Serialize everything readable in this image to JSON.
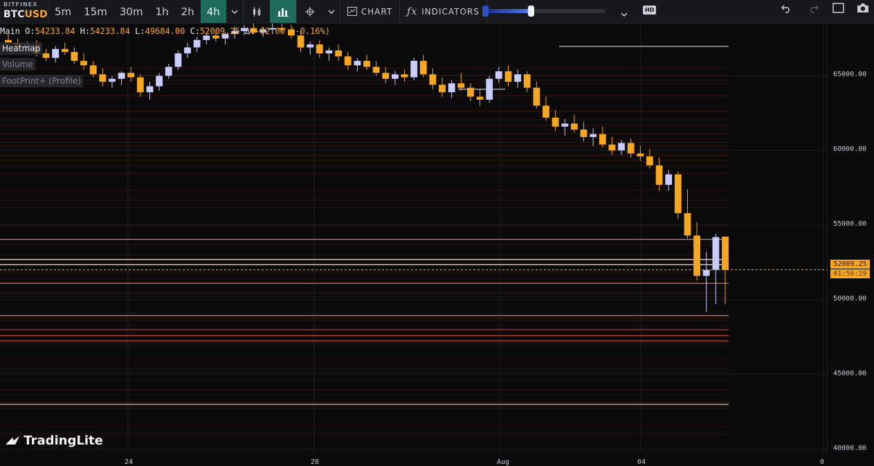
{
  "toolbar": {
    "exchange": "BITFINEX",
    "pair_base": "BTC",
    "pair_quote": "USD",
    "timeframes": [
      "5m",
      "15m",
      "30m",
      "1h",
      "2h",
      "4h"
    ],
    "active_timeframe": "4h",
    "chart_label": "CHART",
    "indicators_label": "INDICATORS",
    "hd_label": "HD",
    "icons": [
      "chevron-down-icon",
      "candles-icon",
      "bars-icon",
      "crosshair-icon",
      "chart-icon",
      "function-icon",
      "undo-icon",
      "redo-icon",
      "window-icon",
      "camera-icon"
    ]
  },
  "info": {
    "main_label": "Main",
    "o_label": "O:",
    "o": "54233.84",
    "h_label": "H:",
    "h": "54233.84",
    "l_label": "L:",
    "l": "49684.00",
    "c_label": "C:",
    "c": "52009.25",
    "delta_label": "Δ:",
    "delta": "-82.00",
    "delta_pct": "(-0.16%)"
  },
  "panes": {
    "heatmap": "Heatmap",
    "volume": "Volume",
    "footprint": "FootPrint+ (Profile)"
  },
  "last_price": {
    "value": "52009.25",
    "countdown": "01:56:29",
    "color": "#f5a623"
  },
  "brand": {
    "logo_text": "TradingLite"
  },
  "colors": {
    "up": "#c8ccff",
    "down": "#f5a623",
    "bg": "#0a0a0b",
    "accent": "#1e6b5c"
  },
  "chart_data": {
    "type": "candlestick",
    "title": "",
    "y_ticks": [
      "65000.00",
      "60000.00",
      "55000.00",
      "50000.00",
      "45000.00",
      "40000.00"
    ],
    "x_ticks": [
      "24",
      "28",
      "Aug",
      "04",
      "0"
    ],
    "ylim": [
      39750,
      68500
    ],
    "candles": [
      [
        67400,
        67800,
        67000,
        67200
      ],
      [
        67200,
        67500,
        66800,
        66900
      ],
      [
        66900,
        67300,
        66500,
        67100
      ],
      [
        67100,
        67400,
        66300,
        66500
      ],
      [
        66500,
        66800,
        66000,
        66200
      ],
      [
        66200,
        67000,
        65900,
        66800
      ],
      [
        66800,
        67200,
        66400,
        66600
      ],
      [
        66600,
        66900,
        65800,
        66000
      ],
      [
        66000,
        66500,
        65400,
        65700
      ],
      [
        65700,
        66000,
        64900,
        65100
      ],
      [
        65100,
        65500,
        64300,
        64600
      ],
      [
        64600,
        65000,
        64200,
        64800
      ],
      [
        64800,
        65300,
        64400,
        65200
      ],
      [
        65200,
        65600,
        64600,
        64900
      ],
      [
        64900,
        65100,
        63600,
        63900
      ],
      [
        63900,
        64600,
        63400,
        64300
      ],
      [
        64300,
        65200,
        64000,
        65000
      ],
      [
        65000,
        65800,
        64800,
        65600
      ],
      [
        65600,
        66700,
        65400,
        66500
      ],
      [
        66500,
        67200,
        66200,
        66900
      ],
      [
        66900,
        67600,
        66600,
        67400
      ],
      [
        67400,
        67900,
        67100,
        67700
      ],
      [
        67700,
        68100,
        67300,
        67500
      ],
      [
        67500,
        67900,
        67100,
        67800
      ],
      [
        67800,
        68300,
        67500,
        68000
      ],
      [
        68000,
        68400,
        67700,
        68200
      ],
      [
        68200,
        68500,
        67800,
        67900
      ],
      [
        67900,
        68300,
        67600,
        68100
      ],
      [
        68100,
        68500,
        67800,
        68200
      ],
      [
        68200,
        68500,
        67900,
        68100
      ],
      [
        68100,
        68400,
        67500,
        67700
      ],
      [
        67700,
        68000,
        66600,
        66900
      ],
      [
        66900,
        67300,
        66400,
        67100
      ],
      [
        67100,
        67400,
        66200,
        66500
      ],
      [
        66500,
        66900,
        66000,
        66700
      ],
      [
        66700,
        67100,
        66000,
        66300
      ],
      [
        66300,
        66600,
        65400,
        65700
      ],
      [
        65700,
        66200,
        65300,
        66000
      ],
      [
        66000,
        66400,
        65400,
        65600
      ],
      [
        65600,
        66000,
        65000,
        65200
      ],
      [
        65200,
        65600,
        64500,
        64800
      ],
      [
        64800,
        65300,
        64400,
        65100
      ],
      [
        65100,
        65400,
        64600,
        64900
      ],
      [
        64900,
        66200,
        64700,
        66000
      ],
      [
        66000,
        66400,
        64900,
        65100
      ],
      [
        65100,
        65500,
        64100,
        64400
      ],
      [
        64400,
        64900,
        63600,
        63900
      ],
      [
        63900,
        64700,
        63500,
        64500
      ],
      [
        64500,
        65200,
        64000,
        64200
      ],
      [
        64200,
        64500,
        63300,
        63600
      ],
      [
        63600,
        64100,
        63000,
        63400
      ],
      [
        63400,
        65000,
        63200,
        64800
      ],
      [
        64800,
        65600,
        64500,
        65300
      ],
      [
        65300,
        65700,
        64300,
        64600
      ],
      [
        64600,
        65400,
        64200,
        65100
      ],
      [
        65100,
        65300,
        63900,
        64200
      ],
      [
        64200,
        64600,
        62800,
        63000
      ],
      [
        63000,
        63600,
        62000,
        62200
      ],
      [
        62200,
        62700,
        61300,
        61600
      ],
      [
        61600,
        62100,
        61000,
        61800
      ],
      [
        61800,
        62400,
        61200,
        61400
      ],
      [
        61400,
        61900,
        60600,
        60900
      ],
      [
        60900,
        61500,
        60300,
        61100
      ],
      [
        61100,
        61600,
        60200,
        60400
      ],
      [
        60400,
        60900,
        59700,
        60000
      ],
      [
        60000,
        60700,
        59700,
        60500
      ],
      [
        60500,
        60800,
        59500,
        59800
      ],
      [
        59800,
        60300,
        59300,
        59600
      ],
      [
        59600,
        60100,
        58800,
        59000
      ],
      [
        59000,
        59500,
        57300,
        57700
      ],
      [
        57700,
        58700,
        57300,
        58400
      ],
      [
        58400,
        58600,
        55400,
        55800
      ],
      [
        55800,
        57400,
        54100,
        54300
      ],
      [
        54300,
        55200,
        51300,
        51600
      ],
      [
        51600,
        53200,
        49200,
        52000
      ],
      [
        52000,
        54400,
        49700,
        54200
      ],
      [
        54233.84,
        54233.84,
        49684.0,
        52009.25
      ]
    ]
  }
}
